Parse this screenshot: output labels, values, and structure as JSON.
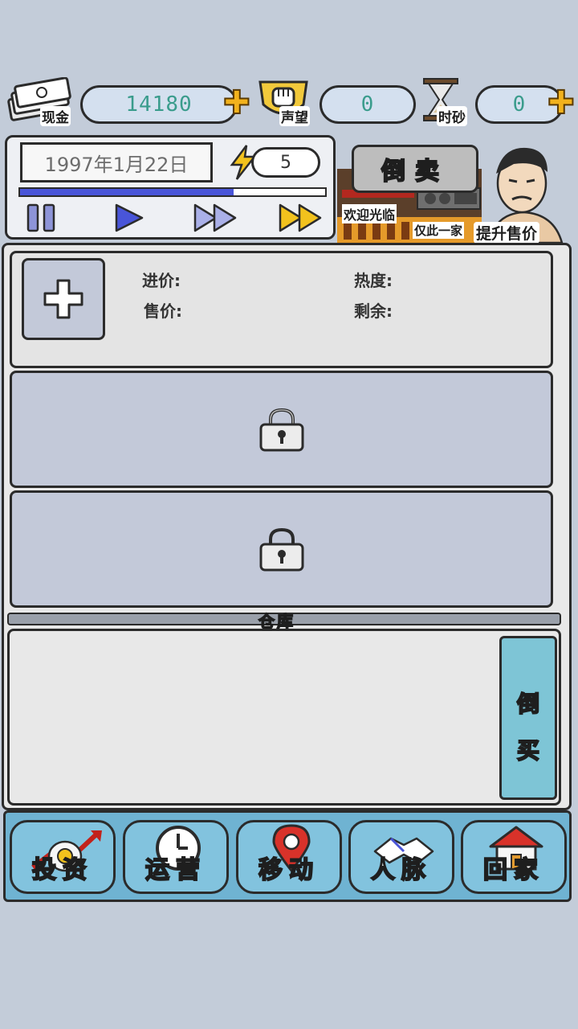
{
  "resources": {
    "cash": {
      "label": "现金",
      "value": "14180"
    },
    "reputation": {
      "label": "声望",
      "value": "0"
    },
    "timesand": {
      "label": "时砂",
      "value": "0"
    }
  },
  "panel": {
    "date": "1997年1月22日",
    "energy": "5",
    "progress": 0.7,
    "sell_button": "倒卖",
    "shop_sign": "欢迎光临",
    "shop_sign2": "仅此一家",
    "upgrade_label": "提升售价"
  },
  "stall": {
    "buy_price_label": "进价:",
    "heat_label": "热度:",
    "sell_price_label": "售价:",
    "remaining_label": "剩余:"
  },
  "warehouse": {
    "title": "仓库",
    "buy_button_1": "倒",
    "buy_button_2": "买"
  },
  "nav": {
    "invest": "投资",
    "operate": "运营",
    "move": "移动",
    "contacts": "人脉",
    "home": "回家"
  },
  "colors": {
    "background": "#c3ccd9",
    "accent_blue": "#4955d8",
    "nav_blue": "#82c3de",
    "gold": "#f2b21d"
  }
}
